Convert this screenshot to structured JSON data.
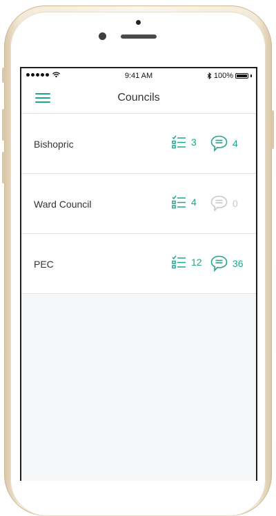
{
  "status_bar": {
    "time": "9:41 AM",
    "battery": "100%"
  },
  "nav": {
    "title": "Councils"
  },
  "councils": [
    {
      "name": "Bishopric",
      "tasks": "3",
      "comments": "4",
      "comments_active": true
    },
    {
      "name": "Ward Council",
      "tasks": "4",
      "comments": "0",
      "comments_active": false
    },
    {
      "name": "PEC",
      "tasks": "12",
      "comments": "36",
      "comments_active": true
    }
  ],
  "icons": {
    "menu": "hamburger-menu-icon",
    "tasks": "checklist-icon",
    "comments": "speech-bubble-icon"
  },
  "colors": {
    "accent": "#1fa58a",
    "inactive": "#c7c9cc",
    "background": "#f6f7f9"
  }
}
